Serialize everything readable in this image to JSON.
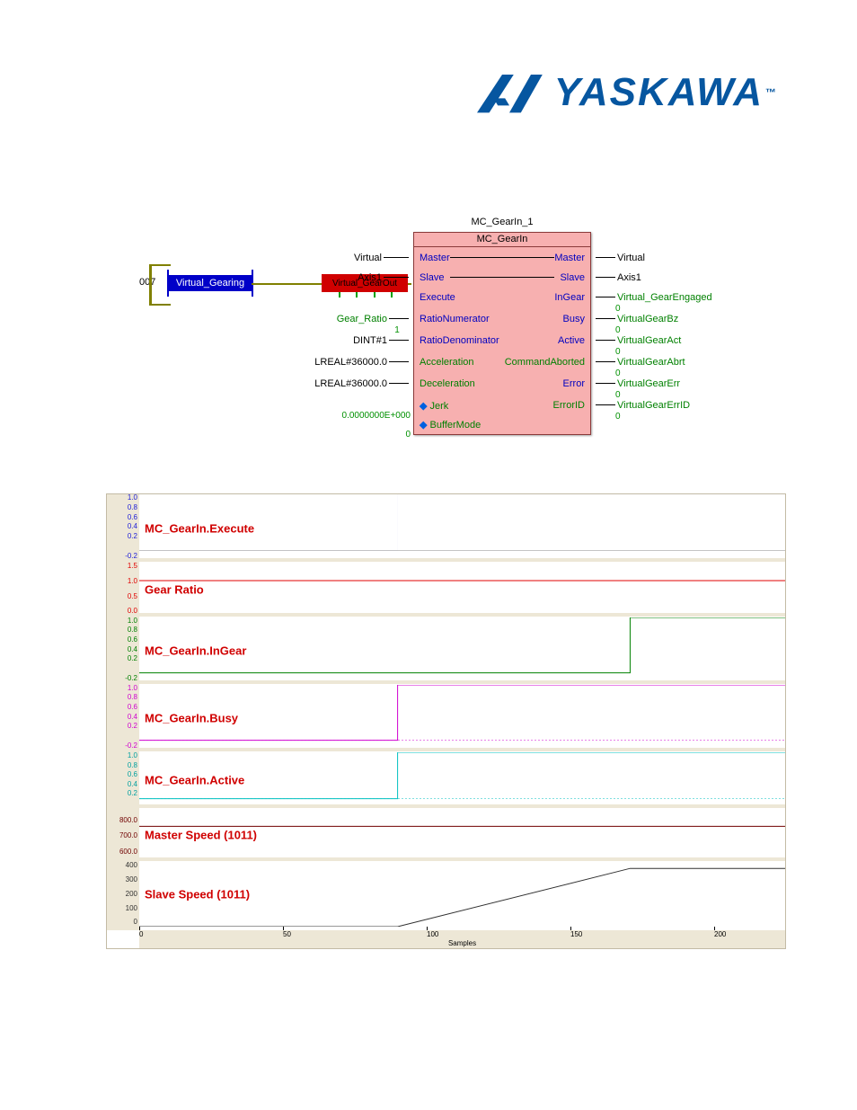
{
  "logo": {
    "brand": "YASKAWA",
    "trademark": "™"
  },
  "fbd": {
    "network_number": "007",
    "contact_label": "Virtual_Gearing",
    "coil_label": "Virtual_GearOut",
    "block": {
      "instance": "MC_GearIn_1",
      "type": "MC_GearIn",
      "left_pins": [
        {
          "port": "Master",
          "connected_var": "Virtual"
        },
        {
          "port": "Slave",
          "connected_var": "Axis1"
        },
        {
          "port": "Execute",
          "connected_var": ""
        },
        {
          "port": "RatioNumerator",
          "connected_var": "Gear_Ratio",
          "literal_below": "1"
        },
        {
          "port": "RatioDenominator",
          "connected_var": "DINT#1"
        },
        {
          "port": "Acceleration",
          "connected_var": "LREAL#36000.0"
        },
        {
          "port": "Deceleration",
          "connected_var": "LREAL#36000.0"
        },
        {
          "port": "Jerk",
          "connected_var": "",
          "float_literal": "0.0000000E+000",
          "optional": true
        },
        {
          "port": "BufferMode",
          "connected_var": "",
          "float_literal": "0",
          "optional": true
        }
      ],
      "right_pins": [
        {
          "port": "Master",
          "connected_var": "Virtual"
        },
        {
          "port": "Slave",
          "connected_var": "Axis1"
        },
        {
          "port": "InGear",
          "connected_var": "Virtual_GearEngaged",
          "value_below": "0"
        },
        {
          "port": "Busy",
          "connected_var": "VirtualGearBz",
          "value_below": "0"
        },
        {
          "port": "Active",
          "connected_var": "VirtualGearAct",
          "value_below": "0"
        },
        {
          "port": "CommandAborted",
          "connected_var": "VirtualGearAbrt",
          "value_below": "0"
        },
        {
          "port": "Error",
          "connected_var": "VirtualGearErr",
          "value_below": "0"
        },
        {
          "port": "ErrorID",
          "connected_var": "VirtualGearErrID",
          "value_below": "0"
        }
      ]
    }
  },
  "scope": {
    "x_axis": {
      "label": "Samples",
      "ticks": [
        0,
        50,
        100,
        150,
        200
      ]
    },
    "strips": [
      {
        "name": "MC_GearIn.Execute",
        "color": "#2020d8",
        "yticks": [
          "1.0",
          "0.8",
          "0.6",
          "0.4",
          "0.2",
          "",
          "-0.2"
        ],
        "yt_color": "#2020d8",
        "top": 0,
        "height": 75
      },
      {
        "name": "Gear Ratio",
        "color": "#e00000",
        "yticks": [
          "1.5",
          "1.0",
          "0.5",
          "0.0"
        ],
        "yt_color": "#e00000",
        "top": 76,
        "height": 60
      },
      {
        "name": "MC_GearIn.InGear",
        "color": "#008000",
        "yticks": [
          "1.0",
          "0.8",
          "0.6",
          "0.4",
          "0.2",
          "",
          "-0.2"
        ],
        "yt_color": "#008000",
        "top": 137,
        "height": 74
      },
      {
        "name": "MC_GearIn.Busy",
        "color": "#d000d0",
        "yticks": [
          "1.0",
          "0.8",
          "0.6",
          "0.4",
          "0.2",
          "",
          "-0.2"
        ],
        "yt_color": "#d000d0",
        "top": 212,
        "height": 74
      },
      {
        "name": "MC_GearIn.Active",
        "color": "#00c0c0",
        "yticks": [
          "1.0",
          "0.8",
          "0.6",
          "0.4",
          "0.2",
          "",
          "-0.2"
        ],
        "yt_color": "#00c0c0",
        "top": 287,
        "height": 62
      },
      {
        "name": "Master Speed (1011)",
        "color": "#700000",
        "yticks": [
          "",
          "800.0",
          "700.0",
          "600.0"
        ],
        "yt_color": "#700000",
        "top": 350,
        "height": 58
      },
      {
        "name": "Slave Speed (1011)",
        "color": "#303030",
        "yticks": [
          "400",
          "300",
          "200",
          "100",
          "0"
        ],
        "yt_color": "#303030",
        "top": 409,
        "height": 72
      }
    ]
  },
  "chart_data": [
    {
      "type": "line",
      "title": "MC_GearIn.Execute",
      "xlabel": "Samples",
      "ylabel": "",
      "ylim": [
        -0.2,
        1.0
      ],
      "x": [
        0,
        100,
        250
      ],
      "values": [
        0,
        1,
        1
      ]
    },
    {
      "type": "line",
      "title": "Gear Ratio",
      "xlabel": "Samples",
      "ylabel": "",
      "ylim": [
        0.0,
        1.5
      ],
      "x": [
        0,
        250
      ],
      "values": [
        1,
        1
      ]
    },
    {
      "type": "line",
      "title": "MC_GearIn.InGear",
      "xlabel": "Samples",
      "ylabel": "",
      "ylim": [
        -0.2,
        1.0
      ],
      "x": [
        0,
        190,
        250
      ],
      "values": [
        0,
        1,
        1
      ]
    },
    {
      "type": "line",
      "title": "MC_GearIn.Busy",
      "xlabel": "Samples",
      "ylabel": "",
      "ylim": [
        -0.2,
        1.0
      ],
      "x": [
        0,
        100,
        250
      ],
      "values": [
        0,
        1,
        1
      ]
    },
    {
      "type": "line",
      "title": "MC_GearIn.Active",
      "xlabel": "Samples",
      "ylabel": "",
      "ylim": [
        -0.2,
        1.0
      ],
      "x": [
        0,
        100,
        250
      ],
      "values": [
        0,
        1,
        1
      ]
    },
    {
      "type": "line",
      "title": "Master Speed (1011)",
      "xlabel": "Samples",
      "ylabel": "",
      "ylim": [
        600,
        900
      ],
      "x": [
        0,
        250
      ],
      "values": [
        800,
        800
      ]
    },
    {
      "type": "line",
      "title": "Slave Speed (1011)",
      "xlabel": "Samples",
      "ylabel": "",
      "ylim": [
        0,
        400
      ],
      "x": [
        0,
        100,
        190,
        250
      ],
      "values": [
        0,
        0,
        360,
        360
      ]
    }
  ]
}
